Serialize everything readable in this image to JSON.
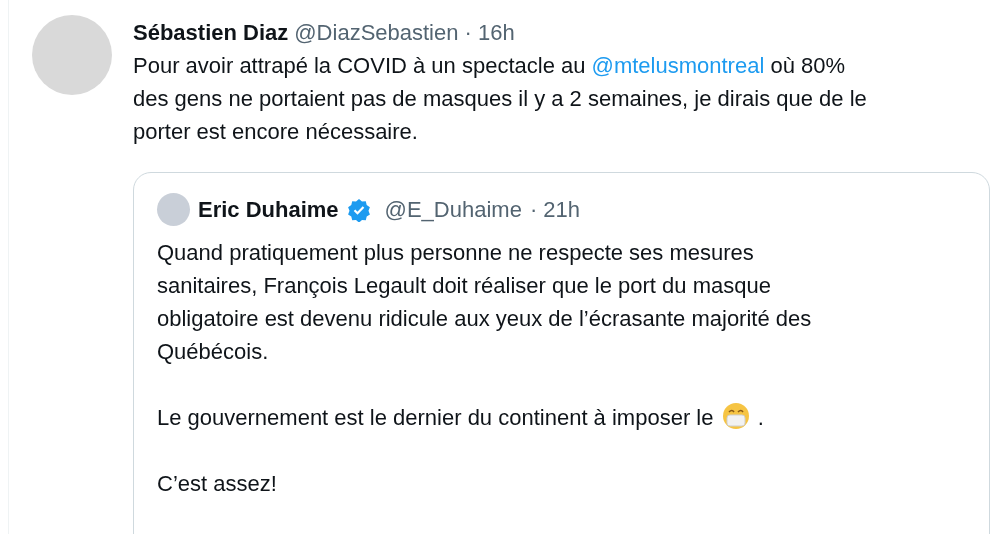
{
  "tweet": {
    "author": {
      "name": "Sébastien Diaz",
      "handle": "@DiazSebastien",
      "time": "· 16h"
    },
    "body": [
      [
        {
          "kind": "text",
          "text": "Pour avoir attrapé la COVID à un spectacle au "
        },
        {
          "kind": "mention",
          "text": "@mtelusmontreal"
        },
        {
          "kind": "text",
          "text": " où 80%"
        }
      ],
      [
        {
          "kind": "text",
          "text": "des gens ne portaient pas de masques il y a 2 semaines, je dirais que de le"
        }
      ],
      [
        {
          "kind": "text",
          "text": "porter est encore nécessaire."
        }
      ]
    ],
    "quote": {
      "author": {
        "name": "Eric Duhaime",
        "verified": true,
        "handle": "@E_Duhaime",
        "time": "· 21h"
      },
      "paragraphs": [
        [
          [
            {
              "kind": "text",
              "text": "Quand pratiquement plus personne ne respecte ses mesures"
            }
          ],
          [
            {
              "kind": "text",
              "text": "sanitaires, François Legault doit réaliser que le port du masque"
            }
          ],
          [
            {
              "kind": "text",
              "text": "obligatoire est devenu ridicule aux yeux de l’écrasante majorité des"
            }
          ],
          [
            {
              "kind": "text",
              "text": "Québécois."
            }
          ]
        ],
        [
          [
            {
              "kind": "text",
              "text": "Le gouvernement est le dernier du continent à imposer le "
            },
            {
              "kind": "emoji"
            },
            {
              "kind": "text",
              "text": " ."
            }
          ]
        ],
        [
          [
            {
              "kind": "text",
              "text": "C’est assez!"
            }
          ]
        ]
      ]
    }
  }
}
